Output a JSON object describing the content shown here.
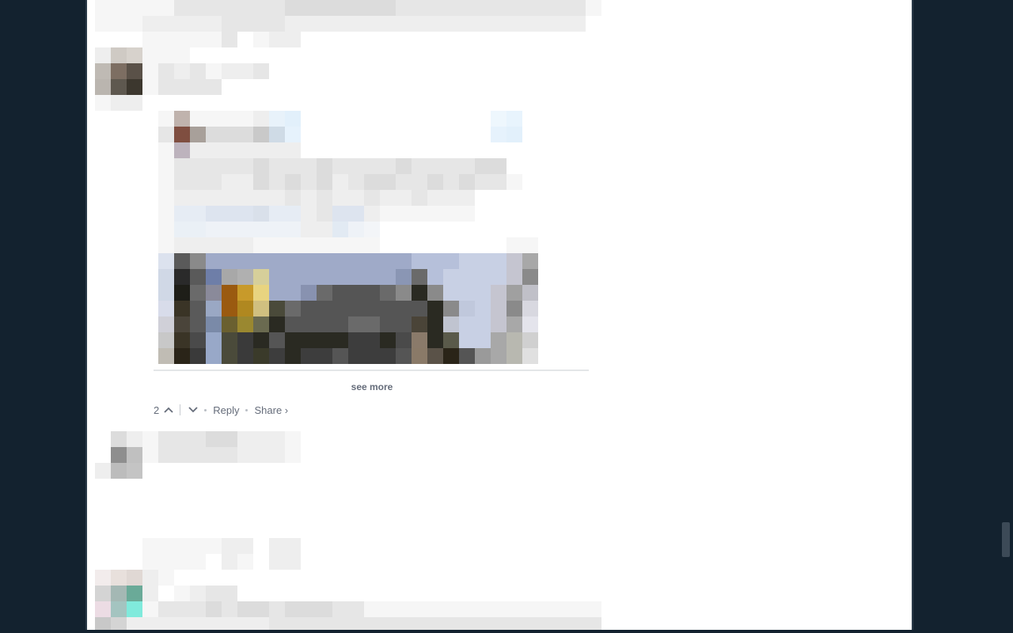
{
  "comment": {
    "vote_count": "2",
    "reply_label": "Reply",
    "share_label": "Share ›",
    "see_more_label": "see more"
  },
  "icons": {
    "upvote": "chevron-up-icon",
    "downvote": "chevron-down-icon"
  },
  "colors": {
    "page_background": "#13222f",
    "panel_background": "#ffffff",
    "footer_text": "#656c7a"
  }
}
